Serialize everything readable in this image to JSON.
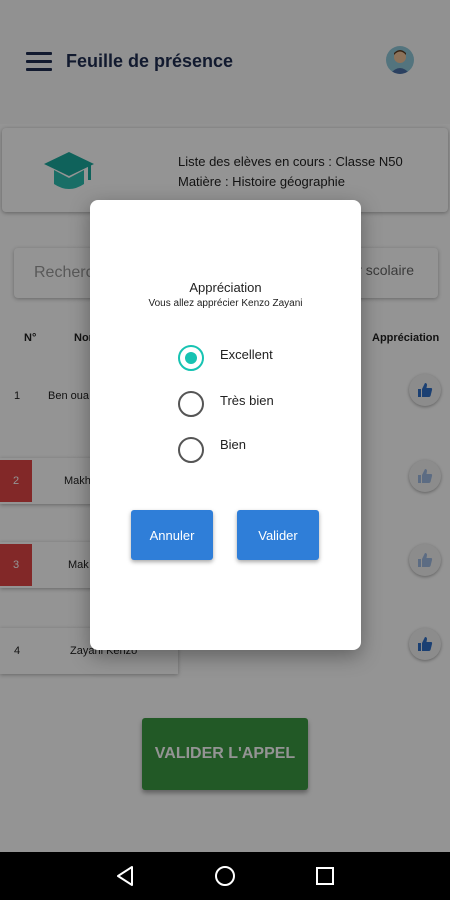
{
  "header": {
    "title": "Feuille de présence"
  },
  "info": {
    "line1": "Liste des elèves en cours : Classe N50",
    "line2": "Matière : Histoire géographie"
  },
  "search": {
    "placeholder": "Recherc",
    "right_text": "r scolaire"
  },
  "table": {
    "headers": {
      "num": "N°",
      "name": "Nor",
      "appreciation": "Appréciation"
    },
    "rows": [
      {
        "num": "1",
        "name": "Ben oua",
        "absent": false,
        "like": "active"
      },
      {
        "num": "2",
        "name": "Makh",
        "absent": true,
        "like": "faded"
      },
      {
        "num": "3",
        "name": "Mak",
        "absent": true,
        "like": "faded"
      },
      {
        "num": "4",
        "name": "Zayani Kenzo",
        "absent": false,
        "like": "active"
      }
    ]
  },
  "validate_call_label": "VALIDER L'APPEL",
  "dialog": {
    "title": "Appréciation",
    "subtitle": "Vous allez apprécier  Kenzo Zayani",
    "options": [
      {
        "label": "Excellent",
        "selected": true
      },
      {
        "label": "Très bien",
        "selected": false
      },
      {
        "label": "Bien",
        "selected": false
      }
    ],
    "cancel_label": "Annuler",
    "confirm_label": "Valider"
  },
  "colors": {
    "primary_text": "#1f2d52",
    "radio_accent": "#17c3b2",
    "dialog_button": "#2f7ed8",
    "validate_green": "#3b9a42",
    "absent_red": "#e04545"
  },
  "navbar": {
    "icons": [
      "back-icon",
      "home-icon",
      "recents-icon"
    ]
  }
}
